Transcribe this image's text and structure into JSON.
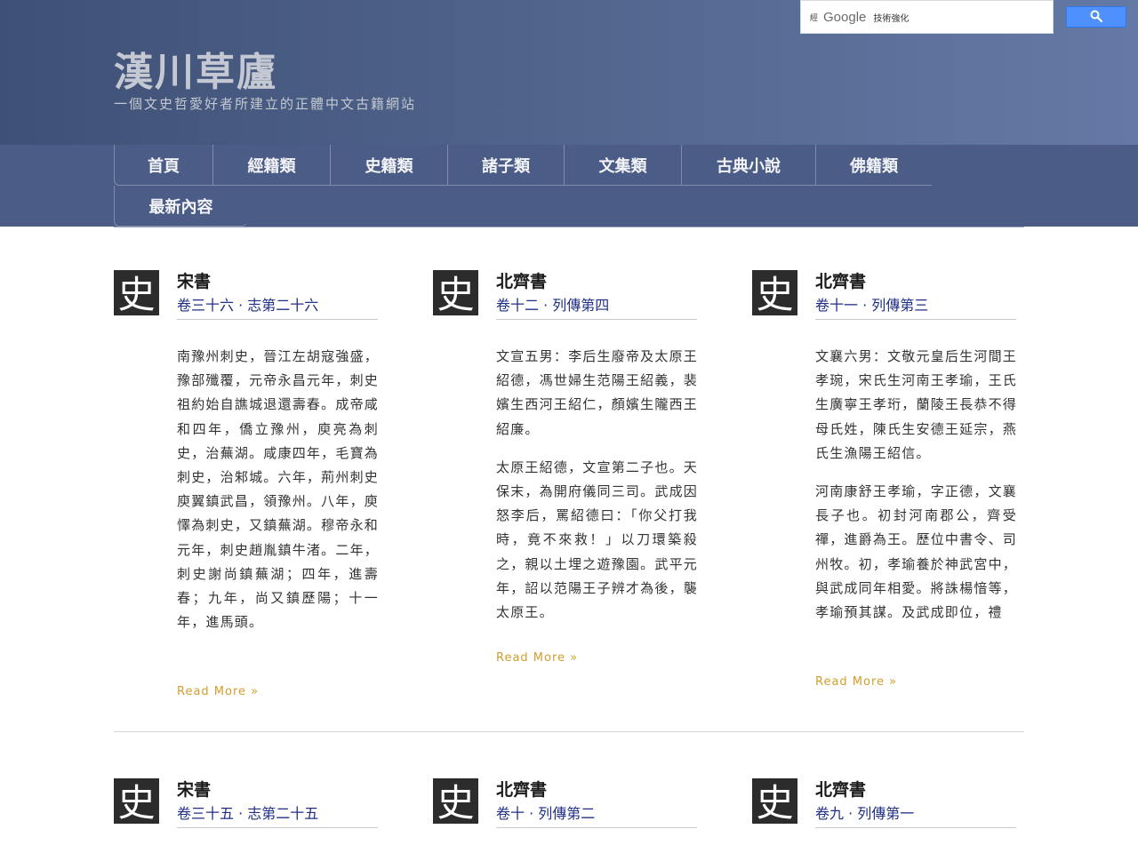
{
  "site": {
    "title": "漢川草廬",
    "description": "一個文史哲愛好者所建立的正體中文古籍網站"
  },
  "search": {
    "brand_small": "經",
    "brand": "Google",
    "enhanced_label": "技術強化"
  },
  "nav": {
    "items": [
      "首頁",
      "經籍類",
      "史籍類",
      "諸子類",
      "文集類",
      "古典小說",
      "佛籍類",
      "最新內容"
    ]
  },
  "posts": [
    {
      "icon_char": "史",
      "book": "宋書",
      "title": "卷三十六 · 志第二十六",
      "paragraphs": [
        "南豫州刺史，晉江左胡寇強盛，豫部殲覆，元帝永昌元年，刺史祖約始自譙城退還壽春。成帝咸和四年，僑立豫州，庾亮為刺史，治蕪湖。咸康四年，毛寶為刺史，治邾城。六年，荊州刺史庾翼鎮武昌，領豫州。八年，庾懌為刺史，又鎮蕪湖。穆帝永和元年，刺史趙胤鎮牛渚。二年，刺史謝尚鎮蕪湖；四年，進壽春；九年，尚又鎮歷陽；十一年，進馬頭。"
      ],
      "read_more": "Read More »"
    },
    {
      "icon_char": "史",
      "book": "北齊書",
      "title": "卷十二 · 列傳第四",
      "paragraphs": [
        "文宣五男：李后生廢帝及太原王紹德，馮世婦生范陽王紹義，裴嬪生西河王紹仁，顏嬪生隴西王紹廉。",
        "太原王紹德，文宣第二子也。天保末，為開府儀同三司。武成因怒李后，罵紹德曰：「你父打我時，竟不來救！」以刀環築殺之，親以土埋之遊豫園。武平元年，詔以范陽王子辨才為後，襲太原王。"
      ],
      "read_more": "Read More »"
    },
    {
      "icon_char": "史",
      "book": "北齊書",
      "title": "卷十一 · 列傳第三",
      "paragraphs": [
        "文襄六男：文敬元皇后生河間王孝琬，宋氏生河南王孝瑜，王氏生廣寧王孝珩，蘭陵王長恭不得母氏姓，陳氏生安德王延宗，燕氏生漁陽王紹信。",
        "河南康舒王孝瑜，字正德，文襄長子也。初封河南郡公，齊受禪，進爵為王。歷位中書令、司州牧。初，孝瑜養於神武宮中，與武成同年相愛。將誅楊愔等，孝瑜預其謀。及武成即位，禮"
      ],
      "read_more": "Read More »"
    },
    {
      "icon_char": "史",
      "book": "宋書",
      "title": "卷三十五 · 志第二十五"
    },
    {
      "icon_char": "史",
      "book": "北齊書",
      "title": "卷十 · 列傳第二"
    },
    {
      "icon_char": "史",
      "book": "北齊書",
      "title": "卷九 · 列傳第一"
    }
  ]
}
